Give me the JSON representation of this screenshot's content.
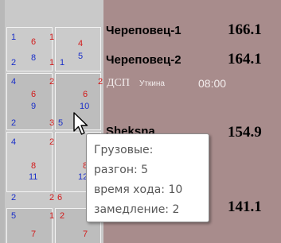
{
  "grid": {
    "rows": [
      {
        "left": {
          "tl": "1",
          "tr": "6",
          "tr2": "1",
          "mid": "",
          "bl": "2",
          "bm": "8"
        },
        "right": {
          "tl": "",
          "tr": "4",
          "tr2": "",
          "mid": "",
          "bl": "1",
          "bm": "5"
        }
      },
      {
        "left": {
          "tl": "4",
          "tr": "6",
          "tr2": "2",
          "mid": "9",
          "bl": "2",
          "bm": "3"
        },
        "right": {
          "tl": "",
          "tr": "6",
          "tr2": "2",
          "mid": "10",
          "bl": "5",
          "bm": "2"
        }
      },
      {
        "left": {
          "tl": "4",
          "tr": "8",
          "tr2": "2",
          "mid": "11",
          "bl": "2",
          "bm": "2"
        },
        "right": {
          "tl": "",
          "tr": "8",
          "tr2": "",
          "mid": "12",
          "bl": "",
          "bm": "6"
        }
      },
      {
        "left": {
          "tl": "5",
          "tr": "7",
          "tr2": "1",
          "mid": "",
          "bl": "",
          "bm": ""
        },
        "right": {
          "tl": "",
          "tr": "7",
          "tr2": "2",
          "mid": "",
          "bl": "",
          "bm": ""
        }
      }
    ]
  },
  "stations": [
    {
      "name": "Череповец-1",
      "km": "166.1"
    },
    {
      "name": "Череповец-2",
      "km": "164.1"
    },
    {
      "name": "Sheksna",
      "km": "154.9"
    },
    {
      "name": "",
      "km": "141.1"
    }
  ],
  "duty": {
    "label": "ДСП",
    "name": "Уткина",
    "time": "08:00"
  },
  "tooltip": {
    "title": "Грузовые:",
    "line1": "разгон: 5",
    "line2": "время хода: 10",
    "line3": "замедление: 2"
  },
  "colors": {
    "number_blue": "#1a2fc8",
    "number_red": "#d21a1a",
    "panel_bg": "#a88c8c"
  }
}
